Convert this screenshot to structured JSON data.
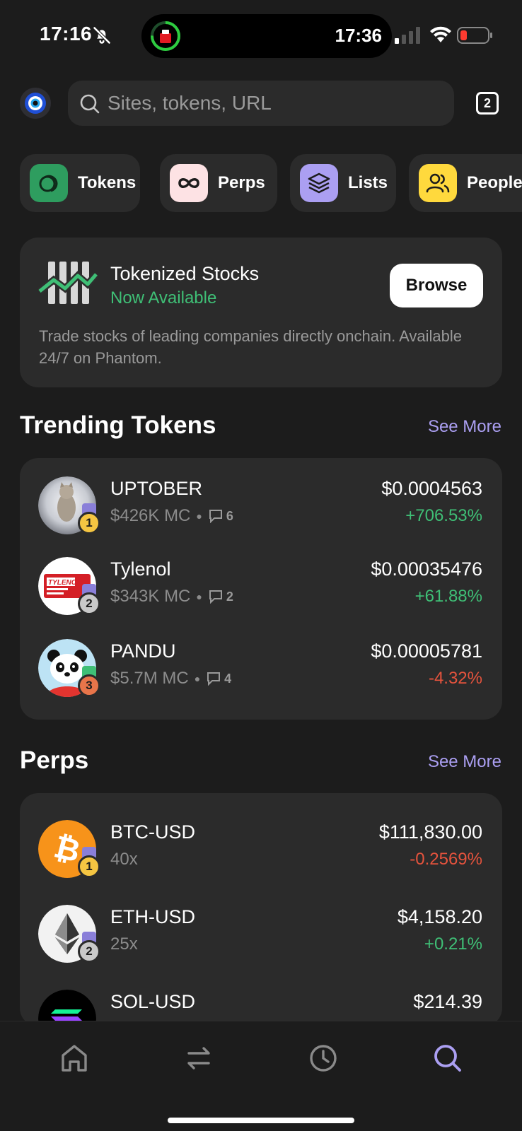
{
  "status_bar": {
    "time": "17:16",
    "island_time": "17:36"
  },
  "search": {
    "placeholder": "Sites, tokens, URL",
    "tabs_count": "2"
  },
  "chips": [
    {
      "label": "Tokens",
      "color": "#2e9d5f"
    },
    {
      "label": "Perps",
      "color": "#fde2e4"
    },
    {
      "label": "Lists",
      "color": "#ab9ff2"
    },
    {
      "label": "People",
      "color": "#ffd93d"
    }
  ],
  "stocks": {
    "title": "Tokenized Stocks",
    "subtitle": "Now Available",
    "button": "Browse",
    "description": "Trade stocks of leading companies directly onchain. Available 24/7 on Phantom."
  },
  "trending": {
    "title": "Trending Tokens",
    "see_more": "See More",
    "tokens": [
      {
        "rank": "1",
        "name": "UPTOBER",
        "mc": "$426K MC",
        "comments": "6",
        "price": "$0.0004563",
        "change": "+706.53%"
      },
      {
        "rank": "2",
        "name": "Tylenol",
        "mc": "$343K MC",
        "comments": "2",
        "price": "$0.00035476",
        "change": "+61.88%"
      },
      {
        "rank": "3",
        "name": "PANDU",
        "mc": "$5.7M MC",
        "comments": "4",
        "price": "$0.00005781",
        "change": "-4.32%"
      }
    ]
  },
  "perps": {
    "title": "Perps",
    "see_more": "See More",
    "items": [
      {
        "rank": "1",
        "name": "BTC-USD",
        "leverage": "40x",
        "price": "$111,830.00",
        "change": "-0.2569%"
      },
      {
        "rank": "2",
        "name": "ETH-USD",
        "leverage": "25x",
        "price": "$4,158.20",
        "change": "+0.21%"
      },
      {
        "name": "SOL-USD",
        "price": "$214.39"
      }
    ]
  },
  "colors": {
    "accent": "#ab9ff2",
    "positive": "#3fbf76",
    "negative": "#e5533d",
    "background": "#1c1c1c",
    "card": "#2b2b2b"
  }
}
